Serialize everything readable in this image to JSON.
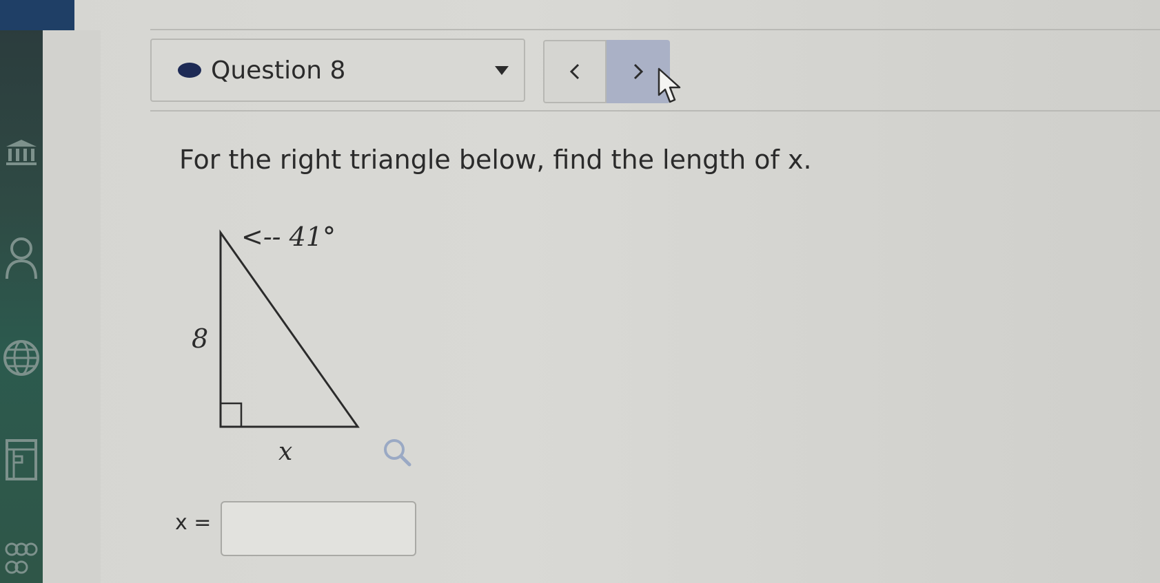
{
  "question_selector": {
    "label": "Question 8",
    "status_color": "#1d2a55"
  },
  "navigation": {
    "prev_icon": "chevron-left-icon",
    "next_icon": "chevron-right-icon"
  },
  "question": {
    "prompt": "For the right triangle below, find the length of x."
  },
  "figure": {
    "angle_label": "<-- 41°",
    "side_label": "8",
    "base_label": "x"
  },
  "answer": {
    "label": "x =",
    "value": ""
  },
  "icons": [
    "bank-icon",
    "user-icon",
    "globe-icon",
    "calculator-icon",
    "group-icon",
    "magnify-icon",
    "mouse-cursor-icon"
  ]
}
